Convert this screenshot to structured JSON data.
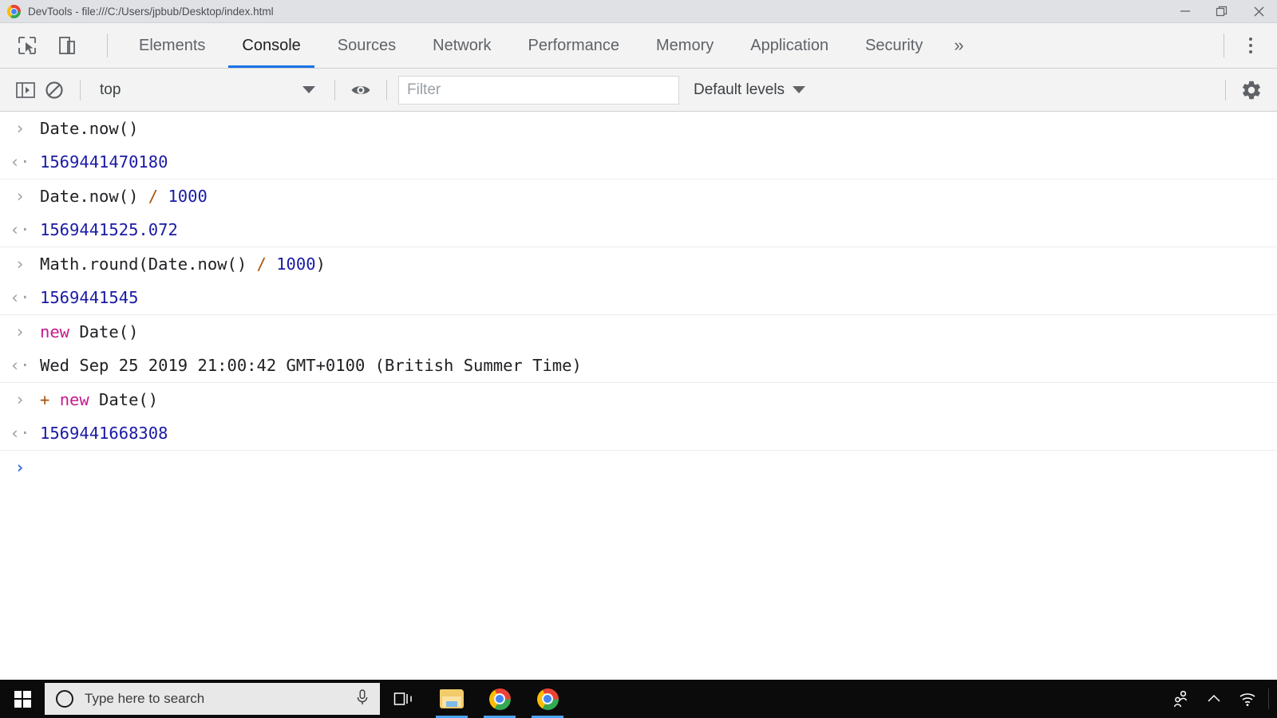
{
  "window": {
    "title": "DevTools - file:///C:/Users/jpbub/Desktop/index.html",
    "logo_icon": "chrome-logo-icon",
    "minimize_icon": "minimize-icon",
    "restore_icon": "restore-icon",
    "close_icon": "close-icon"
  },
  "devtools": {
    "inspect_icon": "inspect-element-icon",
    "device_toolbar_icon": "device-toolbar-icon",
    "tabs": [
      {
        "label": "Elements",
        "active": false
      },
      {
        "label": "Console",
        "active": true
      },
      {
        "label": "Sources",
        "active": false
      },
      {
        "label": "Network",
        "active": false
      },
      {
        "label": "Performance",
        "active": false
      },
      {
        "label": "Memory",
        "active": false
      },
      {
        "label": "Application",
        "active": false
      },
      {
        "label": "Security",
        "active": false
      }
    ],
    "more_tabs_label": "»",
    "main_menu_icon": "kebab-menu-icon"
  },
  "console_toolbar": {
    "sidebar_toggle_icon": "console-sidebar-icon",
    "clear_console_icon": "clear-console-icon",
    "context_value": "top",
    "context_caret_icon": "chevron-down-icon",
    "live_expression_icon": "eye-icon",
    "filter_placeholder": "Filter",
    "filter_value": "",
    "levels_label": "Default levels",
    "levels_caret_icon": "chevron-down-icon",
    "settings_icon": "gear-icon"
  },
  "console": {
    "input_marker": "›",
    "output_marker": "‹·",
    "entries": [
      {
        "type": "input",
        "marker": "›",
        "tokens": [
          {
            "text": "Date.now()",
            "cls": "tok-plain"
          }
        ]
      },
      {
        "type": "output",
        "marker": "‹·",
        "tokens": [
          {
            "text": "1569441470180",
            "cls": "result-num"
          }
        ],
        "separator": true
      },
      {
        "type": "input",
        "marker": "›",
        "tokens": [
          {
            "text": "Date.now() ",
            "cls": "tok-plain"
          },
          {
            "text": "/",
            "cls": "tok-op"
          },
          {
            "text": " ",
            "cls": "tok-plain"
          },
          {
            "text": "1000",
            "cls": "tok-num"
          }
        ]
      },
      {
        "type": "output",
        "marker": "‹·",
        "tokens": [
          {
            "text": "1569441525.072",
            "cls": "result-num"
          }
        ],
        "separator": true
      },
      {
        "type": "input",
        "marker": "›",
        "tokens": [
          {
            "text": "Math.round(Date.now() ",
            "cls": "tok-plain"
          },
          {
            "text": "/",
            "cls": "tok-op"
          },
          {
            "text": " ",
            "cls": "tok-plain"
          },
          {
            "text": "1000",
            "cls": "tok-num"
          },
          {
            "text": ")",
            "cls": "tok-plain"
          }
        ]
      },
      {
        "type": "output",
        "marker": "‹·",
        "tokens": [
          {
            "text": "1569441545",
            "cls": "result-num"
          }
        ],
        "separator": true
      },
      {
        "type": "input",
        "marker": "›",
        "tokens": [
          {
            "text": "new",
            "cls": "tok-kw"
          },
          {
            "text": " Date()",
            "cls": "tok-plain"
          }
        ]
      },
      {
        "type": "output",
        "marker": "‹·",
        "tokens": [
          {
            "text": "Wed Sep 25 2019 21:00:42 GMT+0100 (British Summer Time)",
            "cls": "result-text"
          }
        ],
        "separator": true
      },
      {
        "type": "input",
        "marker": "›",
        "tokens": [
          {
            "text": "+",
            "cls": "tok-op"
          },
          {
            "text": " ",
            "cls": "tok-plain"
          },
          {
            "text": "new",
            "cls": "tok-kw"
          },
          {
            "text": " Date()",
            "cls": "tok-plain"
          }
        ]
      },
      {
        "type": "output",
        "marker": "‹·",
        "tokens": [
          {
            "text": "1569441668308",
            "cls": "result-num"
          }
        ],
        "separator": true
      }
    ],
    "prompt": {
      "marker": "›",
      "value": ""
    }
  },
  "taskbar": {
    "start_icon": "windows-start-icon",
    "cortana_icon": "cortana-circle-icon",
    "search_placeholder": "Type here to search",
    "search_value": "",
    "microphone_icon": "microphone-icon",
    "task_view_icon": "task-view-icon",
    "items": [
      {
        "icon": "file-explorer-icon",
        "running": true
      },
      {
        "icon": "chrome-icon",
        "running": true
      },
      {
        "icon": "chrome-icon",
        "running": true
      }
    ],
    "tray": [
      {
        "icon": "people-share-icon"
      },
      {
        "icon": "show-hidden-icons-chevron-up-icon"
      },
      {
        "icon": "network-wifi-icon"
      }
    ]
  },
  "colors": {
    "accent_blue": "#1a73e8",
    "result_blue": "#1a1aa6",
    "keyword_magenta": "#c41a8c",
    "operator_orange": "#a8530a",
    "titlebar_gray": "#dfe1e5",
    "toolbar_gray": "#f3f3f3",
    "taskbar_black": "#0b0b0b"
  }
}
